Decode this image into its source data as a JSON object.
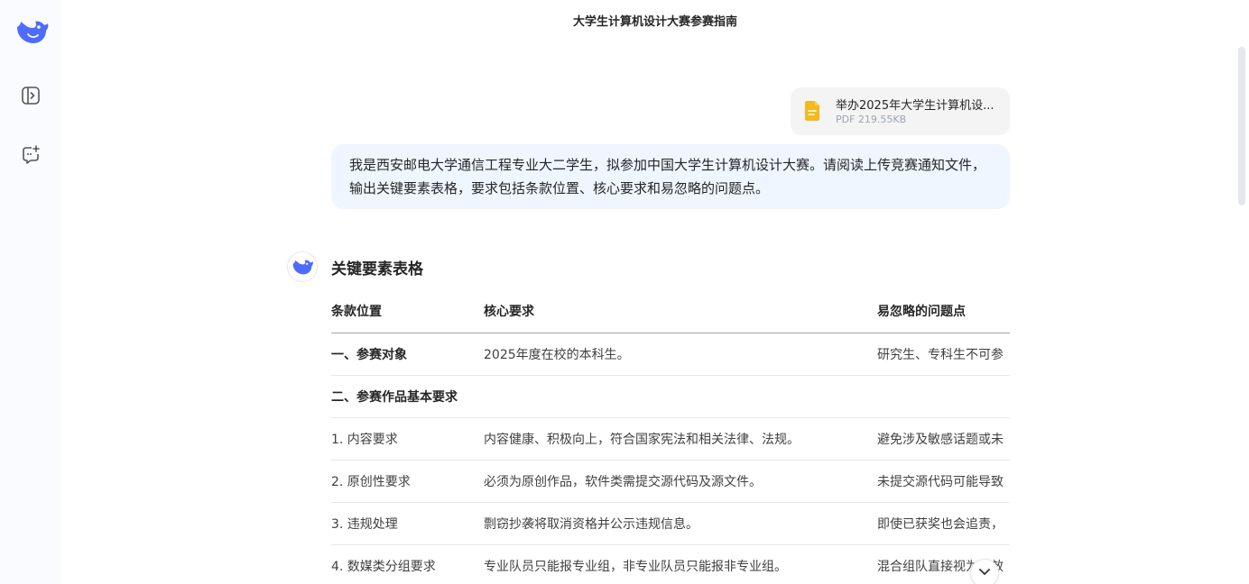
{
  "header": {
    "title": "大学生计算机设计大赛参赛指南"
  },
  "sidebar": {
    "icons": [
      "deepseek-whale-logo",
      "expand-sidebar-icon",
      "new-chat-icon"
    ]
  },
  "file": {
    "name": "举办2025年大学生计算机设...",
    "meta": "PDF 219.55KB"
  },
  "user_message": "我是西安邮电大学通信工程专业大二学生，拟参加中国大学生计算机设计大赛。请阅读上传竞赛通知文件，输出关键要素表格，要求包括条款位置、核心要求和易忽略的问题点。",
  "response": {
    "heading": "关键要素表格",
    "table": {
      "headers": [
        "条款位置",
        "核心要求",
        "易忽略的问题点"
      ],
      "rows": [
        {
          "c1": "一、参赛对象",
          "c2": "2025年度在校的本科生。",
          "c3": "研究生、专科生不可参"
        },
        {
          "c1": "二、参赛作品基本要求",
          "c2": "",
          "c3": ""
        },
        {
          "c1": "1. 内容要求",
          "c2": "内容健康、积极向上，符合国家宪法和相关法律、法规。",
          "c3": "避免涉及敏感话题或未"
        },
        {
          "c1": "2. 原创性要求",
          "c2": "必须为原创作品，软件类需提交源代码及源文件。",
          "c3": "未提交源代码可能导致"
        },
        {
          "c1": "3. 违规处理",
          "c2": "剽窃抄袭将取消资格并公示违规信息。",
          "c3": "即使已获奖也会追责，"
        },
        {
          "c1": "4. 数媒类分组要求",
          "c2": "专业队员只能报专业组，非专业队员只能报非专业组。",
          "c3": "混合组队直接视为无效"
        }
      ]
    }
  },
  "colors": {
    "brand": "#4d6bfe",
    "user_bubble": "#eff6ff",
    "file_icon": "#f5b81d"
  }
}
